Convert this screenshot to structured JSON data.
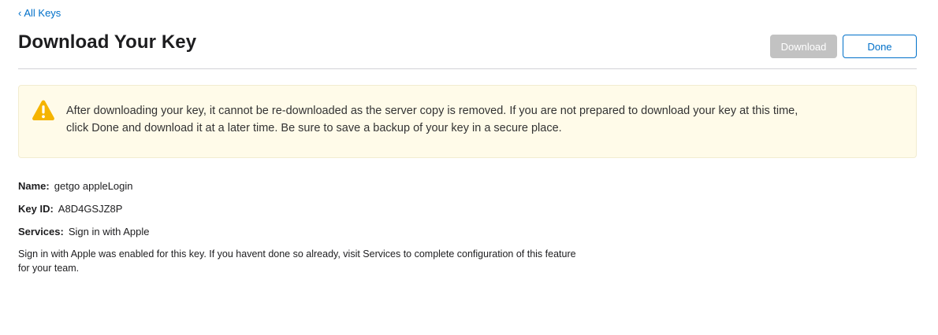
{
  "nav": {
    "back_chevron": "‹",
    "back_label": "All Keys"
  },
  "header": {
    "title": "Download Your Key",
    "download_label": "Download",
    "done_label": "Done"
  },
  "warning": {
    "icon": "warning-triangle-icon",
    "color": "#f5b400",
    "text": "After downloading your key, it cannot be re-downloaded as the server copy is removed. If you are not prepared to download your key at this time, click Done and download it at a later time. Be sure to save a backup of your key in a secure place."
  },
  "key": {
    "name_label": "Name:",
    "name_value": "getgo appleLogin",
    "keyid_label": "Key ID:",
    "keyid_value": "A8D4GSJZ8P",
    "services_label": "Services:",
    "services_value": "Sign in with Apple",
    "services_note": "Sign in with Apple was enabled for this key. If you havent done so already, visit Services to complete configuration of this feature for your team."
  },
  "colors": {
    "accent": "#0070c9",
    "disabled_button": "#c2c2c2",
    "warning_bg": "#fffbe9"
  }
}
